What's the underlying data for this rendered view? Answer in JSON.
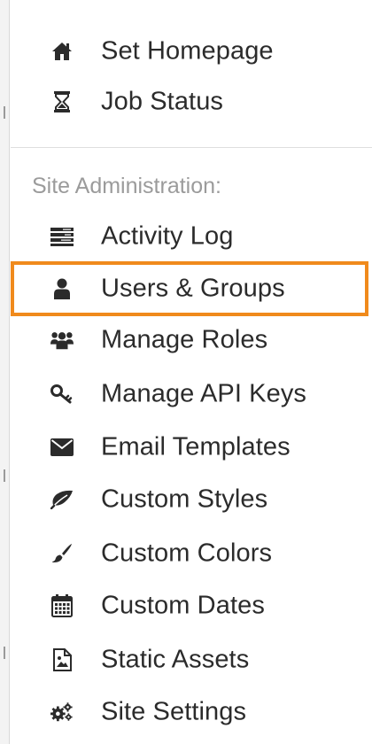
{
  "menu": {
    "top_items": [
      {
        "label": "Set Homepage",
        "icon": "home-icon"
      },
      {
        "label": "Job Status",
        "icon": "hourglass-icon"
      }
    ],
    "section_title": "Site Administration:",
    "admin_items": [
      {
        "label": "Activity Log",
        "icon": "list-icon"
      },
      {
        "label": "Users & Groups",
        "icon": "user-icon",
        "highlighted": true
      },
      {
        "label": "Manage Roles",
        "icon": "users-icon"
      },
      {
        "label": "Manage API Keys",
        "icon": "key-icon"
      },
      {
        "label": "Email Templates",
        "icon": "envelope-icon"
      },
      {
        "label": "Custom Styles",
        "icon": "leaf-icon"
      },
      {
        "label": "Custom Colors",
        "icon": "paintbrush-icon"
      },
      {
        "label": "Custom Dates",
        "icon": "calendar-icon"
      },
      {
        "label": "Static Assets",
        "icon": "image-file-icon"
      },
      {
        "label": "Site Settings",
        "icon": "gears-icon"
      }
    ]
  },
  "colors": {
    "highlight_border": "#f08a1c",
    "text": "#2b2b2b",
    "icon": "#2b2b2b",
    "section_title": "#9b9b9b"
  }
}
